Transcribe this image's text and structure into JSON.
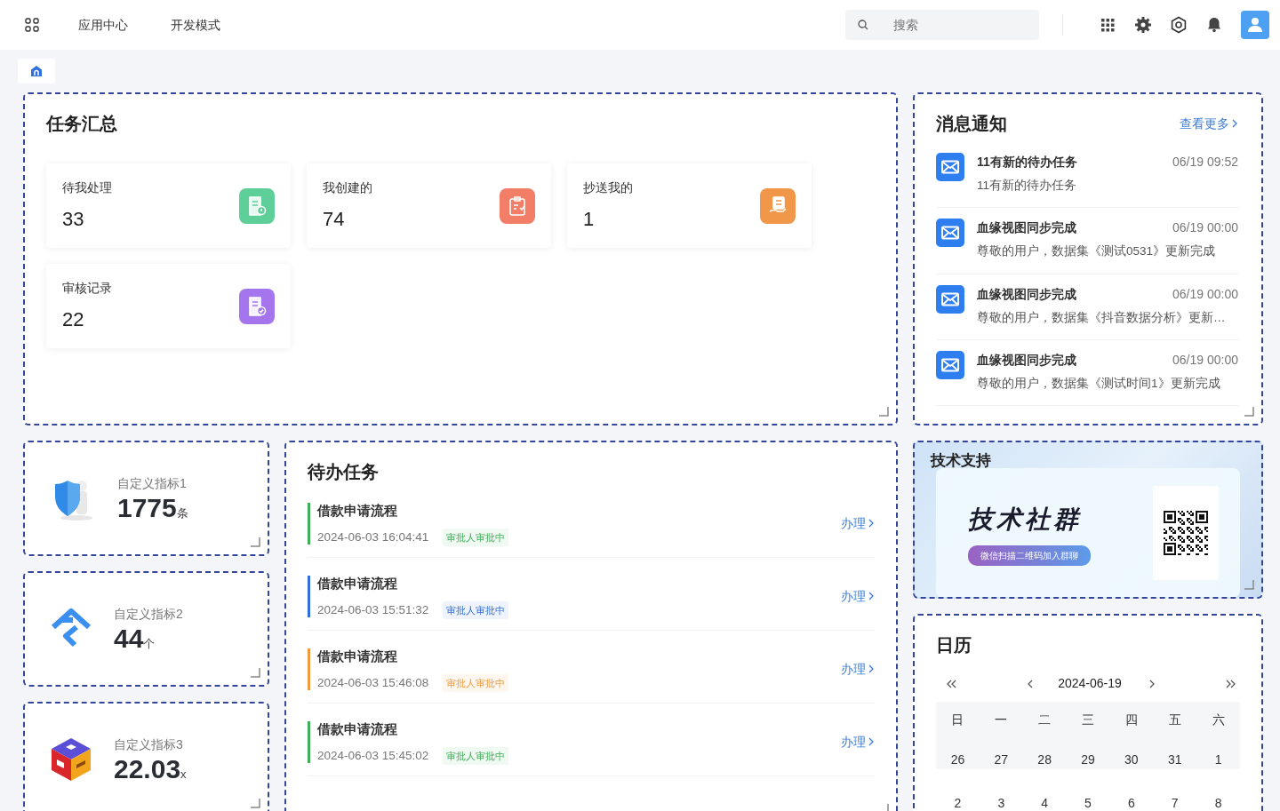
{
  "topbar": {
    "nav": [
      "应用中心",
      "开发模式"
    ],
    "search": {
      "placeholder": "搜索"
    }
  },
  "task_summary": {
    "title": "任务汇总",
    "stats": [
      {
        "label": "待我处理",
        "value": "33",
        "color": "#5fcf9a",
        "kind": "pending"
      },
      {
        "label": "我创建的",
        "value": "74",
        "color": "#f27e68",
        "kind": "created"
      },
      {
        "label": "抄送我的",
        "value": "1",
        "color": "#f0974a",
        "kind": "copied"
      },
      {
        "label": "审核记录",
        "value": "22",
        "color": "#a575ee",
        "kind": "review"
      }
    ]
  },
  "notifications": {
    "title": "消息通知",
    "more": "查看更多",
    "items": [
      {
        "title": "11有新的待办任务",
        "time": "06/19 09:52",
        "body": "11有新的待办任务"
      },
      {
        "title": "血缘视图同步完成",
        "time": "06/19 00:00",
        "body": "尊敬的用户，数据集《测试0531》更新完成"
      },
      {
        "title": "血缘视图同步完成",
        "time": "06/19 00:00",
        "body": "尊敬的用户，数据集《抖音数据分析》更新…"
      },
      {
        "title": "血缘视图同步完成",
        "time": "06/19 00:00",
        "body": "尊敬的用户，数据集《测试时间1》更新完成"
      }
    ]
  },
  "metrics": [
    {
      "label": "自定义指标1",
      "value": "1775",
      "unit": "条",
      "kind": "shield"
    },
    {
      "label": "自定义指标2",
      "value": "44",
      "unit": "个",
      "kind": "chevrons"
    },
    {
      "label": "自定义指标3",
      "value": "22.03",
      "unit": "x",
      "kind": "cube"
    }
  ],
  "todo": {
    "title": "待办任务",
    "items": [
      {
        "title": "借款申请流程",
        "time": "2024-06-03 16:04:41",
        "status": "审批人审批中",
        "action": "办理",
        "color": "#3daf57"
      },
      {
        "title": "借款申请流程",
        "time": "2024-06-03 15:51:32",
        "status": "审批人审批中",
        "action": "办理",
        "color": "#2f6fd6"
      },
      {
        "title": "借款申请流程",
        "time": "2024-06-03 15:46:08",
        "status": "审批人审批中",
        "action": "办理",
        "color": "#ef9a3c"
      },
      {
        "title": "借款申请流程",
        "time": "2024-06-03 15:45:02",
        "status": "审批人审批中",
        "action": "办理",
        "color": "#3daf57"
      }
    ]
  },
  "support": {
    "title": "技术支持",
    "banner_title": "技术社群",
    "banner_button": "微信扫描二维码加入群聊"
  },
  "calendar": {
    "title": "日历",
    "date": "2024-06-19",
    "weekdays": [
      "日",
      "一",
      "二",
      "三",
      "四",
      "五",
      "六"
    ],
    "weeks": [
      [
        "26",
        "27",
        "28",
        "29",
        "30",
        "31",
        "1"
      ],
      [
        "2",
        "3",
        "4",
        "5",
        "6",
        "7",
        "8"
      ]
    ]
  }
}
